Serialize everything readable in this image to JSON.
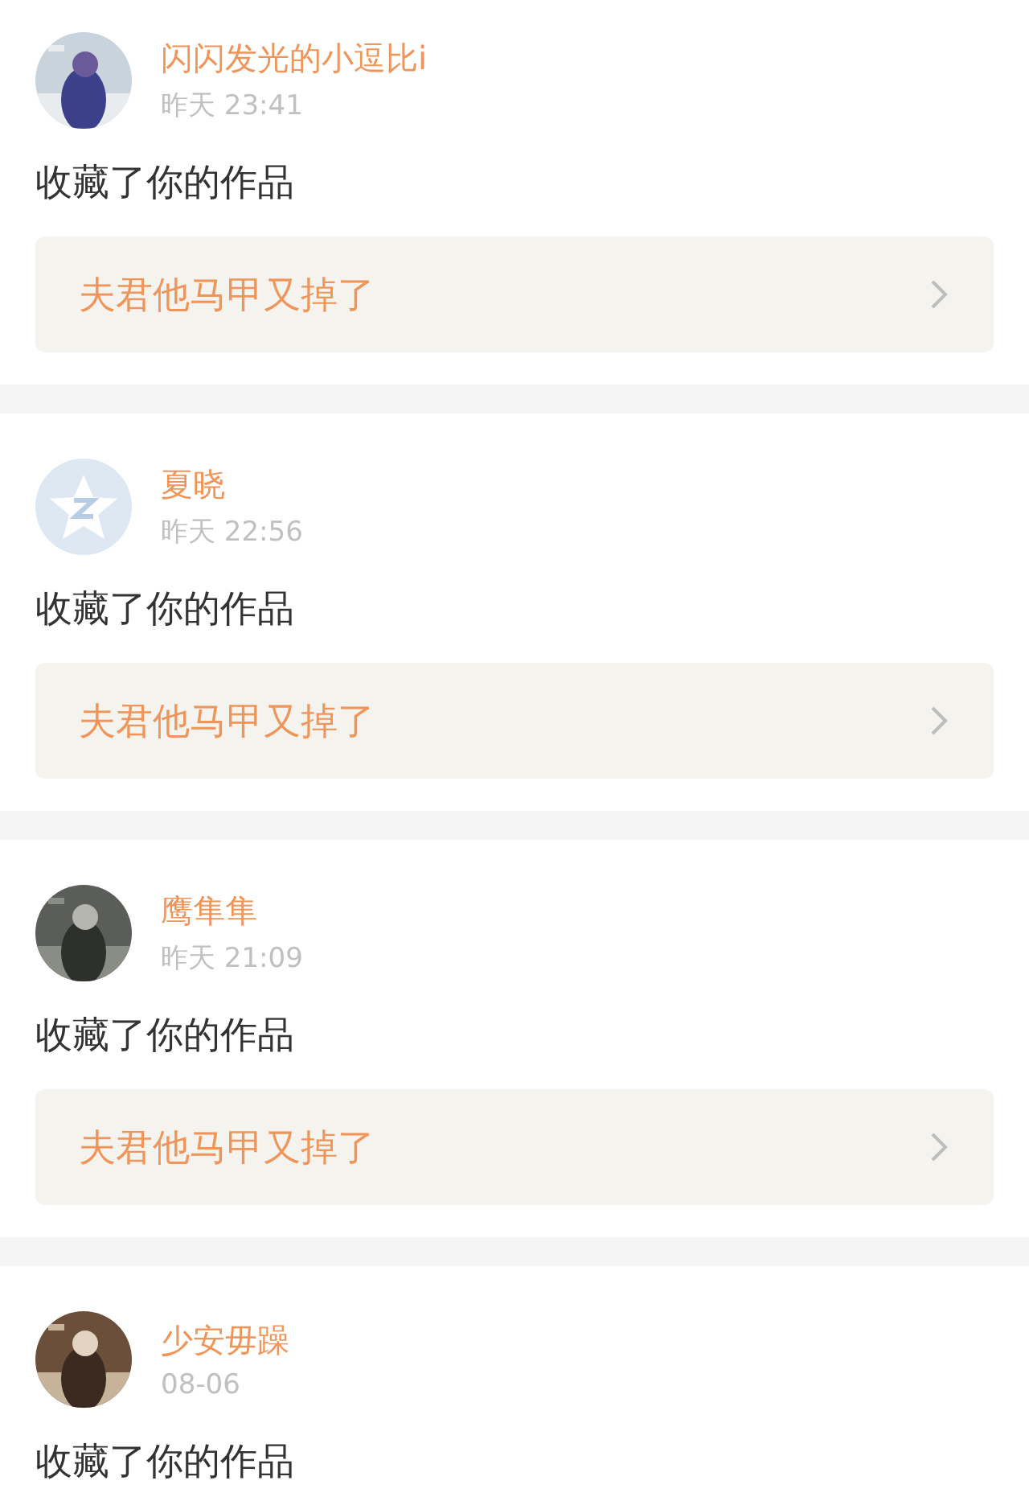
{
  "notifications": [
    {
      "name": "闪闪发光的小逗比i",
      "time": "昨天 23:41",
      "action": "收藏了你的作品",
      "work": {
        "title": "夫君他马甲又掉了"
      }
    },
    {
      "avatar": {
        "kind": "default"
      },
      "name": "夏晓",
      "time": "昨天 22:56",
      "action": "收藏了你的作品",
      "work": {
        "title": "夫君他马甲又掉了"
      }
    },
    {
      "name": "鹰隼隼",
      "time": "昨天 21:09",
      "action": "收藏了你的作品",
      "work": {
        "title": "夫君他马甲又掉了"
      }
    },
    {
      "name": "少安毋躁",
      "time": "08-06",
      "action": "收藏了你的作品"
    }
  ]
}
